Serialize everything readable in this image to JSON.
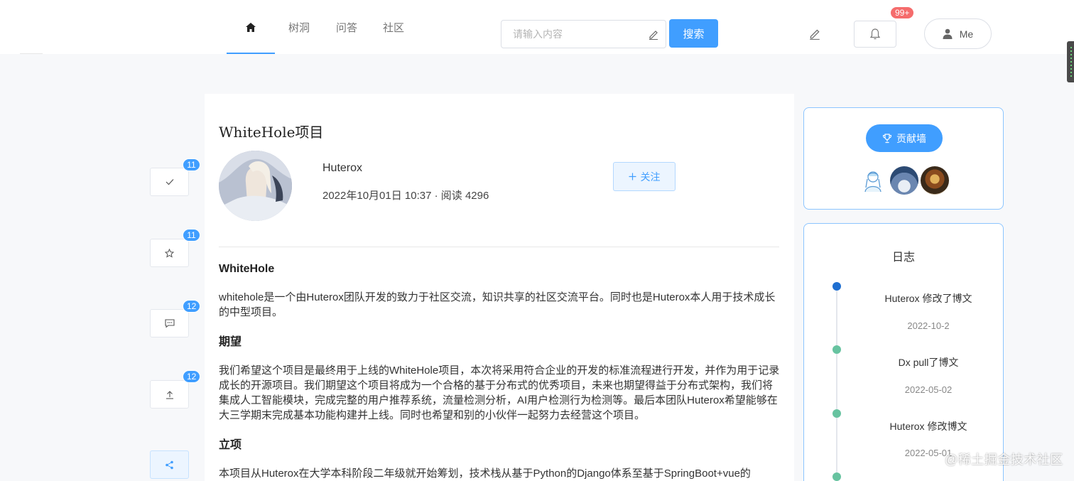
{
  "nav": {
    "items": [
      "树洞",
      "问答",
      "社区"
    ]
  },
  "search": {
    "placeholder": "请输入内容",
    "button_label": "搜索"
  },
  "notifications": {
    "badge": "99+"
  },
  "user": {
    "label": "Me"
  },
  "actions": {
    "like_count": "11",
    "star_count": "11",
    "comment_count": "12",
    "share_count": "12"
  },
  "article": {
    "title": "WhiteHole项目",
    "author": "Huterox",
    "meta": "2022年10月01日 10:37 · 阅读 4296",
    "follow_label": "关注",
    "sections": [
      {
        "heading": "WhiteHole",
        "body": "whitehole是一个由Huterox团队开发的致力于社区交流，知识共享的社区交流平台。同时也是Huterox本人用于技术成长的中型项目。"
      },
      {
        "heading": "期望",
        "body": "我们希望这个项目是最终用于上线的WhiteHole项目，本次将采用符合企业的开发的标准流程进行开发，并作为用于记录成长的开源项目。我们期望这个项目将成为一个合格的基于分布式的优秀项目，未来也期望得益于分布式架构，我们将集成人工智能模块，完成完整的用户推荐系统，流量检测分析，AI用户检测行为检测等。最后本团队Huterox希望能够在大三学期末完成基本功能构建并上线。同时也希望和别的小伙伴一起努力去经营这个项目。"
      },
      {
        "heading": "立项",
        "body": "本项目从Huterox在大学本科阶段二年级就开始筹划，技术栈从基于Python的Django体系至基于SpringBoot+vue的"
      }
    ]
  },
  "sidebar": {
    "wall_label": "贡献墙",
    "log_title": "日志",
    "log_entries": [
      {
        "text": "Huterox 修改了博文",
        "date": "2022-10-2"
      },
      {
        "text": "Dx pull了博文",
        "date": "2022-05-02"
      },
      {
        "text": "Huterox 修改博文",
        "date": "2022-05-01"
      }
    ]
  },
  "watermark": "@稀土掘金技术社区",
  "colors": {
    "accent": "#409eff",
    "danger": "#f56c6c",
    "timeline_active": "#1f6fd1",
    "timeline_done": "#67c3a0"
  },
  "icons": {
    "home": "home-icon",
    "pen": "pen-icon",
    "bell": "bell-icon",
    "user": "user-icon",
    "check": "check-icon",
    "star": "star-icon",
    "comment": "comment-icon",
    "upload": "upload-icon",
    "share": "share-icon",
    "trophy": "trophy-icon",
    "plus": "plus-icon"
  }
}
